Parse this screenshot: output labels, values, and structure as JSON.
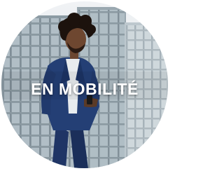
{
  "title": "EN MOBILITÉ",
  "colors": {
    "title": "#ffffff",
    "sky": "#e4e8ec",
    "building_glass": "#9fb0ba",
    "suit": "#243f75"
  },
  "image": {
    "subject": "businessman-walking-with-smartphone"
  }
}
